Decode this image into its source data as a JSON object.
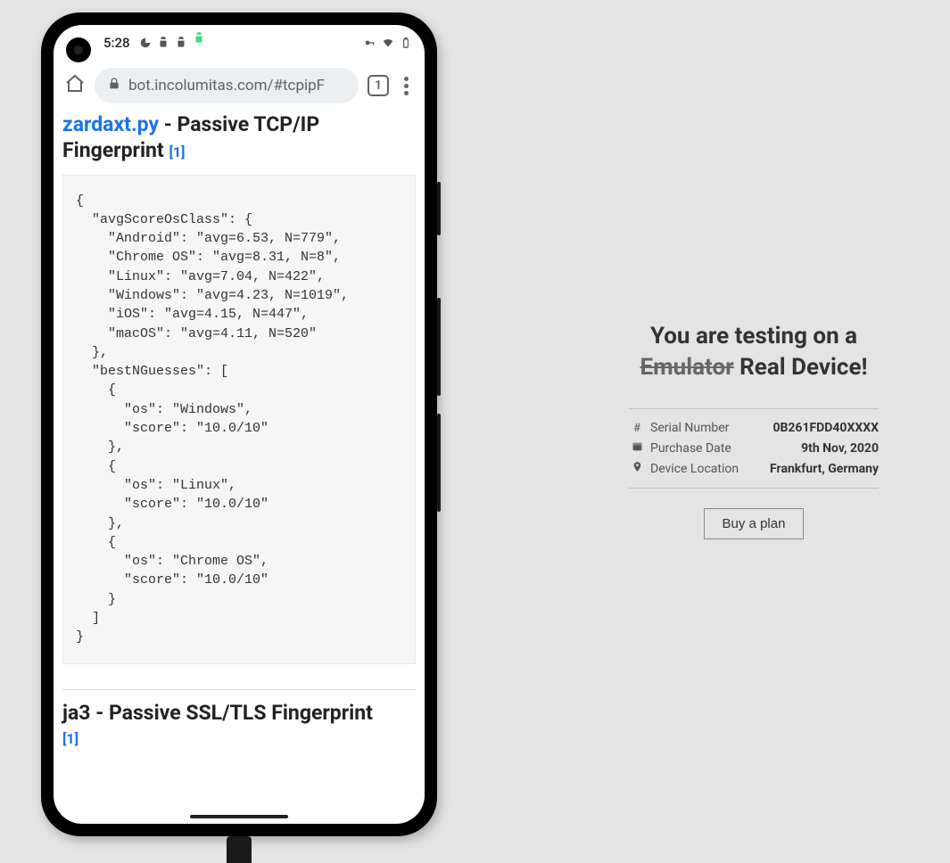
{
  "status": {
    "time": "5:28"
  },
  "browser": {
    "url": "bot.incolumitas.com/#tcpipF",
    "tab_count": "1"
  },
  "page": {
    "h1_link": "zardaxt.py",
    "h1_rest": " - Passive TCP/IP Fingerprint ",
    "h1_ref": "[1]",
    "code": "{\n  \"avgScoreOsClass\": {\n    \"Android\": \"avg=6.53, N=779\",\n    \"Chrome OS\": \"avg=8.31, N=8\",\n    \"Linux\": \"avg=7.04, N=422\",\n    \"Windows\": \"avg=4.23, N=1019\",\n    \"iOS\": \"avg=4.15, N=447\",\n    \"macOS\": \"avg=4.11, N=520\"\n  },\n  \"bestNGuesses\": [\n    {\n      \"os\": \"Windows\",\n      \"score\": \"10.0/10\"\n    },\n    {\n      \"os\": \"Linux\",\n      \"score\": \"10.0/10\"\n    },\n    {\n      \"os\": \"Chrome OS\",\n      \"score\": \"10.0/10\"\n    }\n  ]\n}",
    "h2_main": "ja3 - Passive SSL/TLS Fingerprint",
    "h2_ref": "[1]"
  },
  "panel": {
    "heading_line1": "You are testing on a",
    "heading_strike": "Emulator",
    "heading_after": " Real Device!",
    "rows": [
      {
        "label": "Serial Number",
        "value": "0B261FDD40XXXX"
      },
      {
        "label": "Purchase Date",
        "value": "9th Nov, 2020"
      },
      {
        "label": "Device Location",
        "value": "Frankfurt, Germany"
      }
    ],
    "cta": "Buy a plan"
  }
}
